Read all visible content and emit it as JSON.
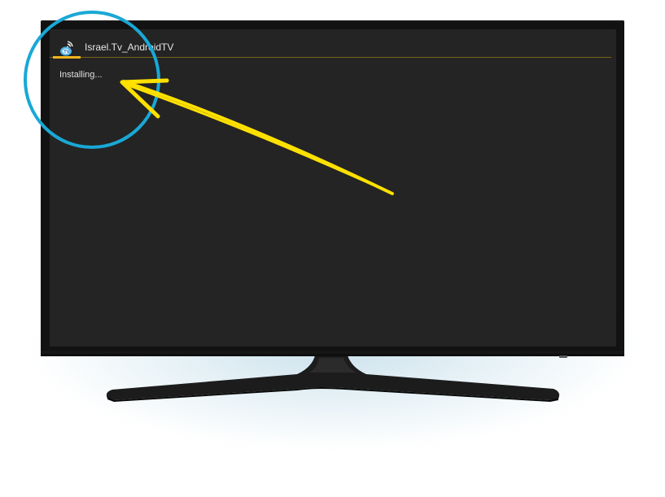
{
  "app": {
    "title": "Israel.Tv_AndroidTV",
    "icon": "wifi-tv-app-icon"
  },
  "main": {
    "status": "Installing..."
  },
  "annotation": {
    "circle_color": "#19a8d6",
    "arrow_color": "#ffe100"
  },
  "colors": {
    "screen_bg": "#242424",
    "accent": "#f0b51e",
    "bezel": "#121212"
  }
}
